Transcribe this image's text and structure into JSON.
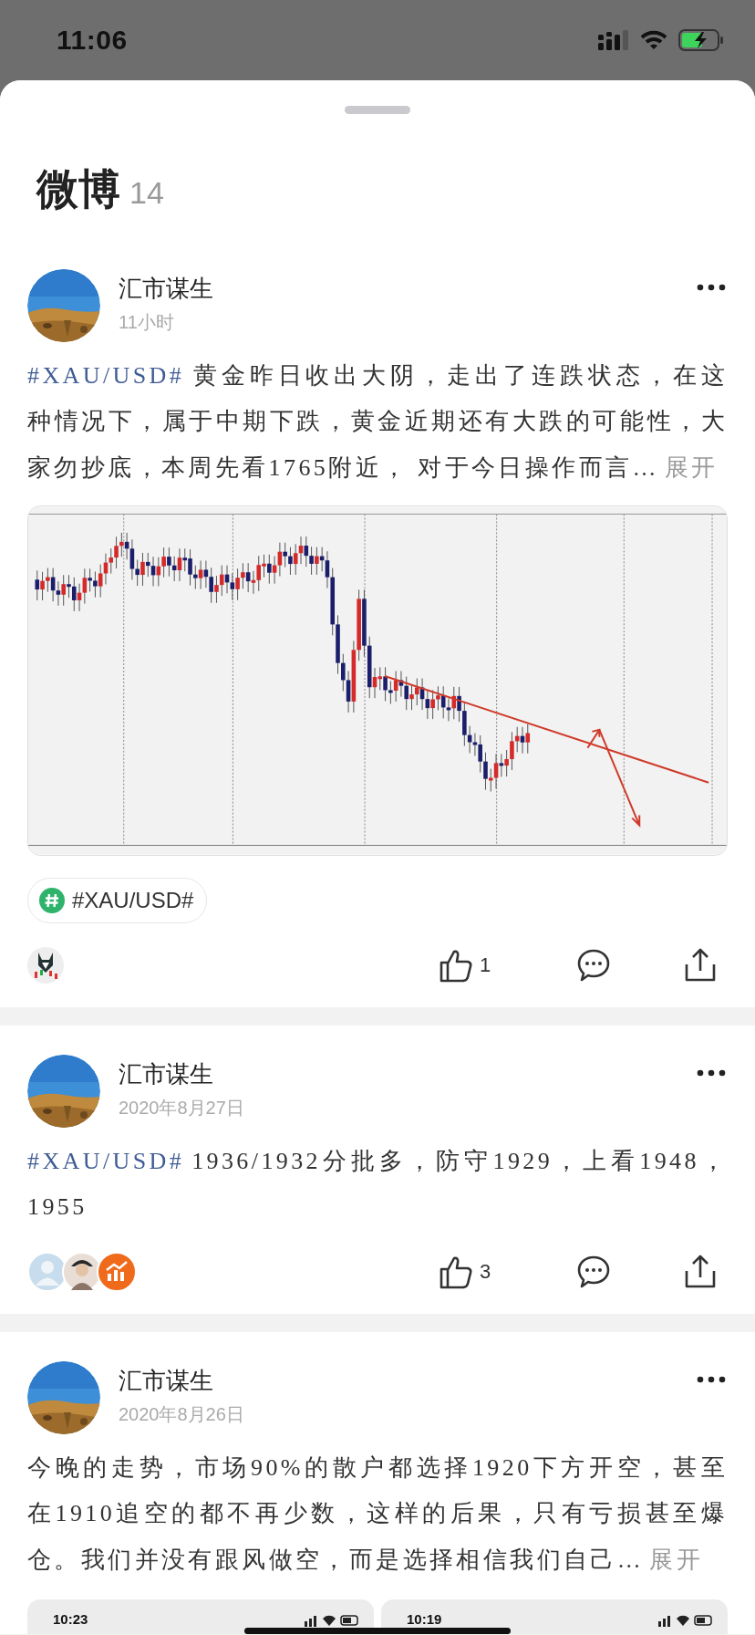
{
  "status_bar": {
    "time": "11:06"
  },
  "sheet": {
    "title": "微博",
    "count": "14"
  },
  "posts": [
    {
      "author": "汇市谋生",
      "time": "11小时",
      "hashtag": "#XAU/USD#",
      "text": "黄金昨日收出大阴，走出了连跌状态，在这种情况下，属于中期下跌，黄金近期还有大跌的可能性，大家勿抄底，本周先看1765附近， 对于今日操作而言…",
      "expand": "展开",
      "media": {
        "kind": "chart"
      },
      "tags": [
        "#XAU/USD#"
      ],
      "likers": [
        {
          "kind": "logo"
        }
      ],
      "likes": "1"
    },
    {
      "author": "汇市谋生",
      "time": "2020年8月27日",
      "hashtag": "#XAU/USD#",
      "text": "1936/1932分批多，防守1929，上看1948，1955",
      "likers": [
        {
          "kind": "default"
        },
        {
          "kind": "person"
        },
        {
          "kind": "app"
        }
      ],
      "likes": "3"
    },
    {
      "author": "汇市谋生",
      "time": "2020年8月26日",
      "text": "今晚的走势，市场90%的散户都选择1920下方开空，甚至在1910追空的都不再少数，这样的后果，只有亏损甚至爆仓。我们并没有跟风做空，而是选择相信我们自己…",
      "expand": "展开",
      "media": {
        "kind": "screenshots",
        "times": [
          "10:23",
          "10:19"
        ]
      }
    }
  ]
}
